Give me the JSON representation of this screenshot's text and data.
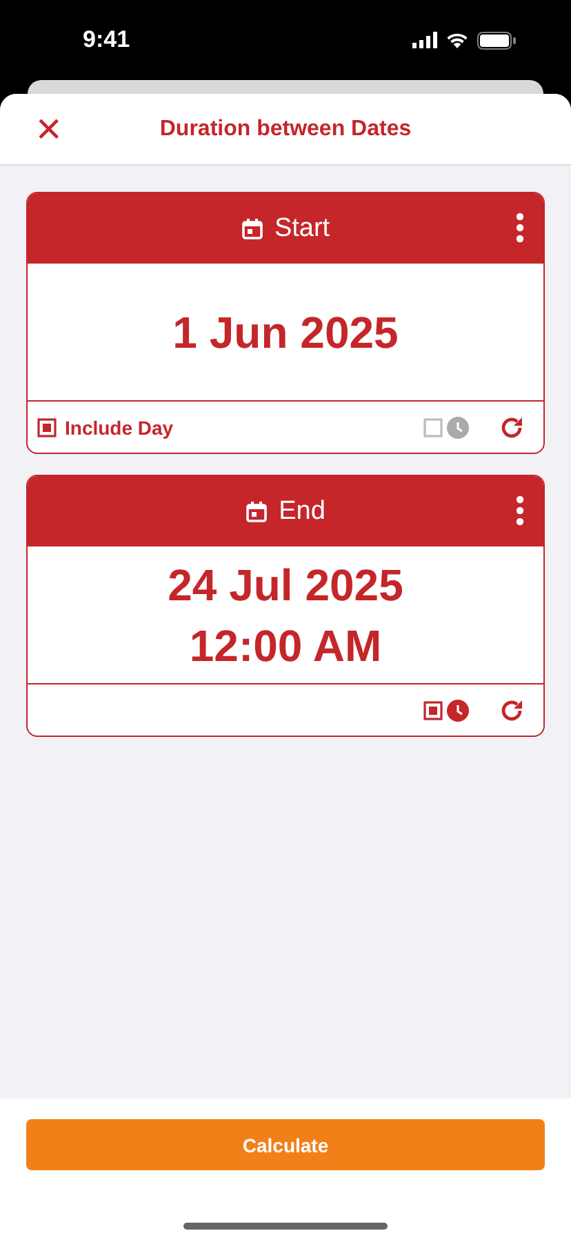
{
  "status_bar": {
    "time": "9:41"
  },
  "header": {
    "close": "×",
    "title": "Duration between Dates"
  },
  "cards": [
    {
      "title": "Start",
      "lines": [
        "1 Jun 2025"
      ],
      "include_day": {
        "label": "Include Day",
        "checked": true
      },
      "time_on": false
    },
    {
      "title": "End",
      "lines": [
        "24 Jul 2025",
        "12:00 AM"
      ],
      "time_on": true
    }
  ],
  "button": "Calculate"
}
